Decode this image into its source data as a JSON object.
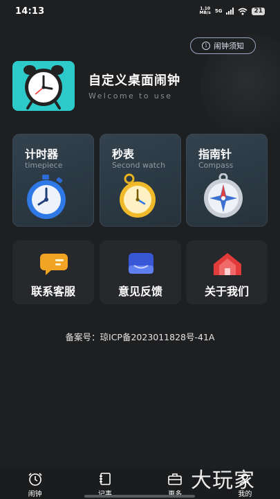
{
  "status_bar": {
    "time": "14:13",
    "network_speed": "1.10",
    "network_unit": "MB/s",
    "signal_label": "5G",
    "battery": "21"
  },
  "header": {
    "notice_button": "闹钟须知",
    "app_title": "自定义桌面闹钟",
    "app_subtitle": "Welcome to use"
  },
  "tools": [
    {
      "title": "计时器",
      "subtitle": "timepiece",
      "icon": "stopwatch-icon"
    },
    {
      "title": "秒表",
      "subtitle": "Second watch",
      "icon": "pocket-watch-icon"
    },
    {
      "title": "指南针",
      "subtitle": "Compass",
      "icon": "compass-icon"
    }
  ],
  "services": [
    {
      "label": "联系客服",
      "icon": "chat-bubble-icon"
    },
    {
      "label": "意见反馈",
      "icon": "feedback-tray-icon"
    },
    {
      "label": "关于我们",
      "icon": "house-icon"
    }
  ],
  "footer": {
    "icp": "备案号：琼ICP备2023011828号-41A"
  },
  "bottom_nav": [
    {
      "label": "闹钟",
      "icon": "alarm-clock-icon"
    },
    {
      "label": "记事",
      "icon": "notebook-icon"
    },
    {
      "label": "更多",
      "icon": "briefcase-icon"
    },
    {
      "label": "我的",
      "icon": "user-icon"
    }
  ],
  "watermark": "大玩家",
  "colors": {
    "background": "#1e1f21",
    "app_icon": "#2ec9c9",
    "tool_card": "#2f3d48",
    "service_card": "#26282b",
    "accent_border": "#9aa8c4"
  }
}
